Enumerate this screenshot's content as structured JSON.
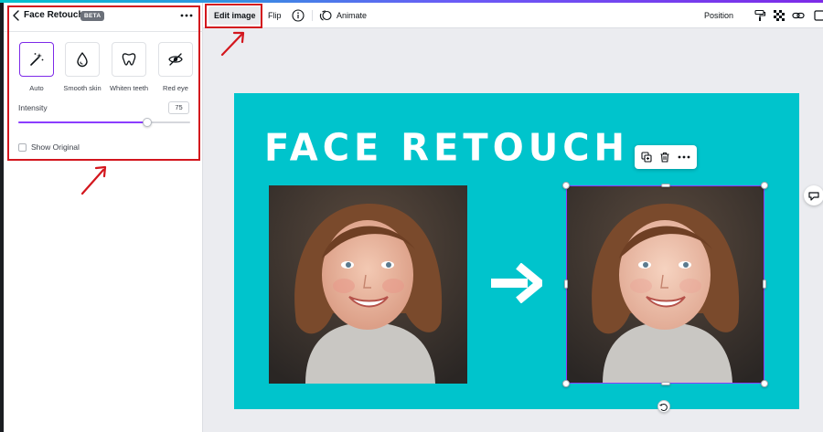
{
  "panel": {
    "title": "Face Retouch",
    "badge": "BETA",
    "effects": [
      {
        "label": "Auto",
        "icon": "magic-wand-icon",
        "selected": true
      },
      {
        "label": "Smooth skin",
        "icon": "droplet-icon",
        "selected": false
      },
      {
        "label": "Whiten teeth",
        "icon": "tooth-icon",
        "selected": false
      },
      {
        "label": "Red eye",
        "icon": "eye-icon",
        "selected": false
      }
    ],
    "intensity": {
      "label": "Intensity",
      "value": "75",
      "fraction": 0.75
    },
    "show_original": {
      "label": "Show Original",
      "checked": false
    }
  },
  "toolbar": {
    "edit_image": "Edit image",
    "flip": "Flip",
    "animate": "Animate",
    "position": "Position",
    "right_icons": [
      "paint-roller-icon",
      "transparency-icon",
      "link-icon",
      "more-tools-icon"
    ]
  },
  "design": {
    "title": "FACE RETOUCH",
    "background": "#00c4cc"
  },
  "colors": {
    "accent": "#7d2ae8",
    "annotation": "#d3161d"
  }
}
